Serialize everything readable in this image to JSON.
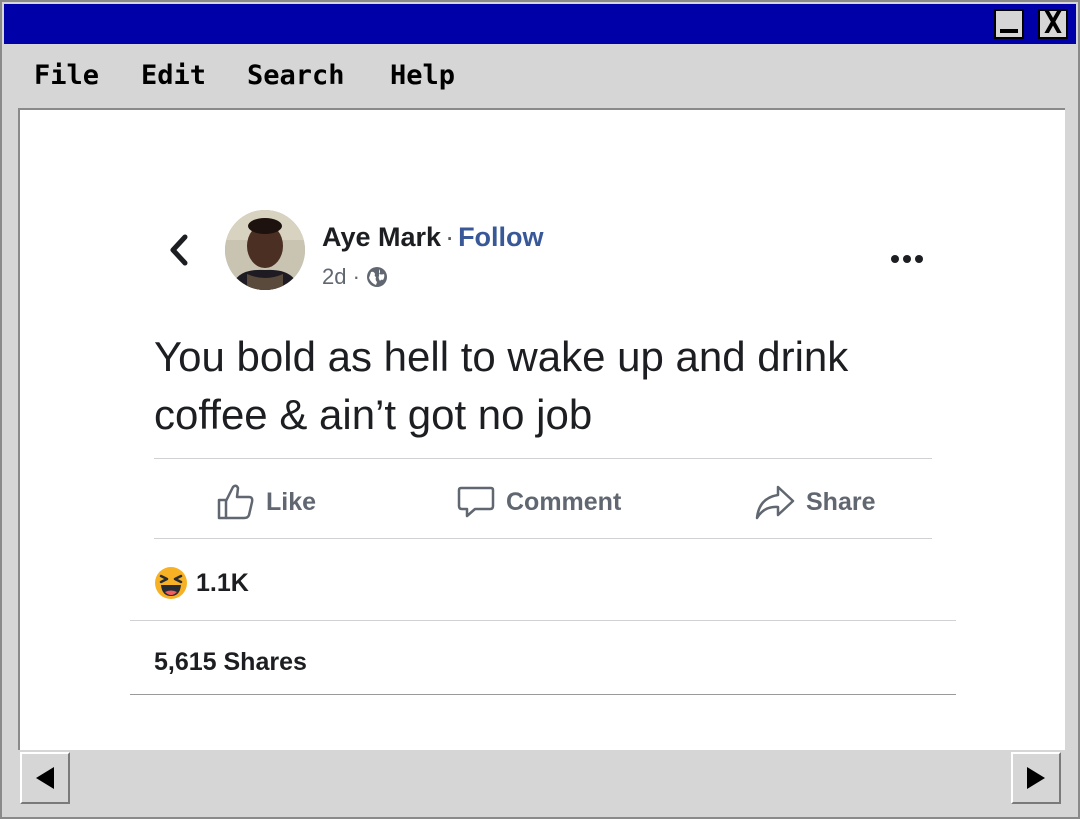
{
  "menu": {
    "items": [
      "File",
      "Edit",
      "Search",
      "Help"
    ]
  },
  "window": {
    "minimize_label": "_",
    "close_label": "X"
  },
  "post": {
    "author": "Aye Mark",
    "separator": "·",
    "follow_label": "Follow",
    "time": "2d ·",
    "text": "You bold as hell to wake up and drink coffee & ain’t got no job",
    "actions": {
      "like": "Like",
      "comment": "Comment",
      "share": "Share"
    },
    "reaction_count": "1.1K",
    "shares_text": "5,615 Shares"
  },
  "colors": {
    "titlebar": "#0000a8",
    "follow": "#385898",
    "reaction_emoji": "#f7b125"
  }
}
